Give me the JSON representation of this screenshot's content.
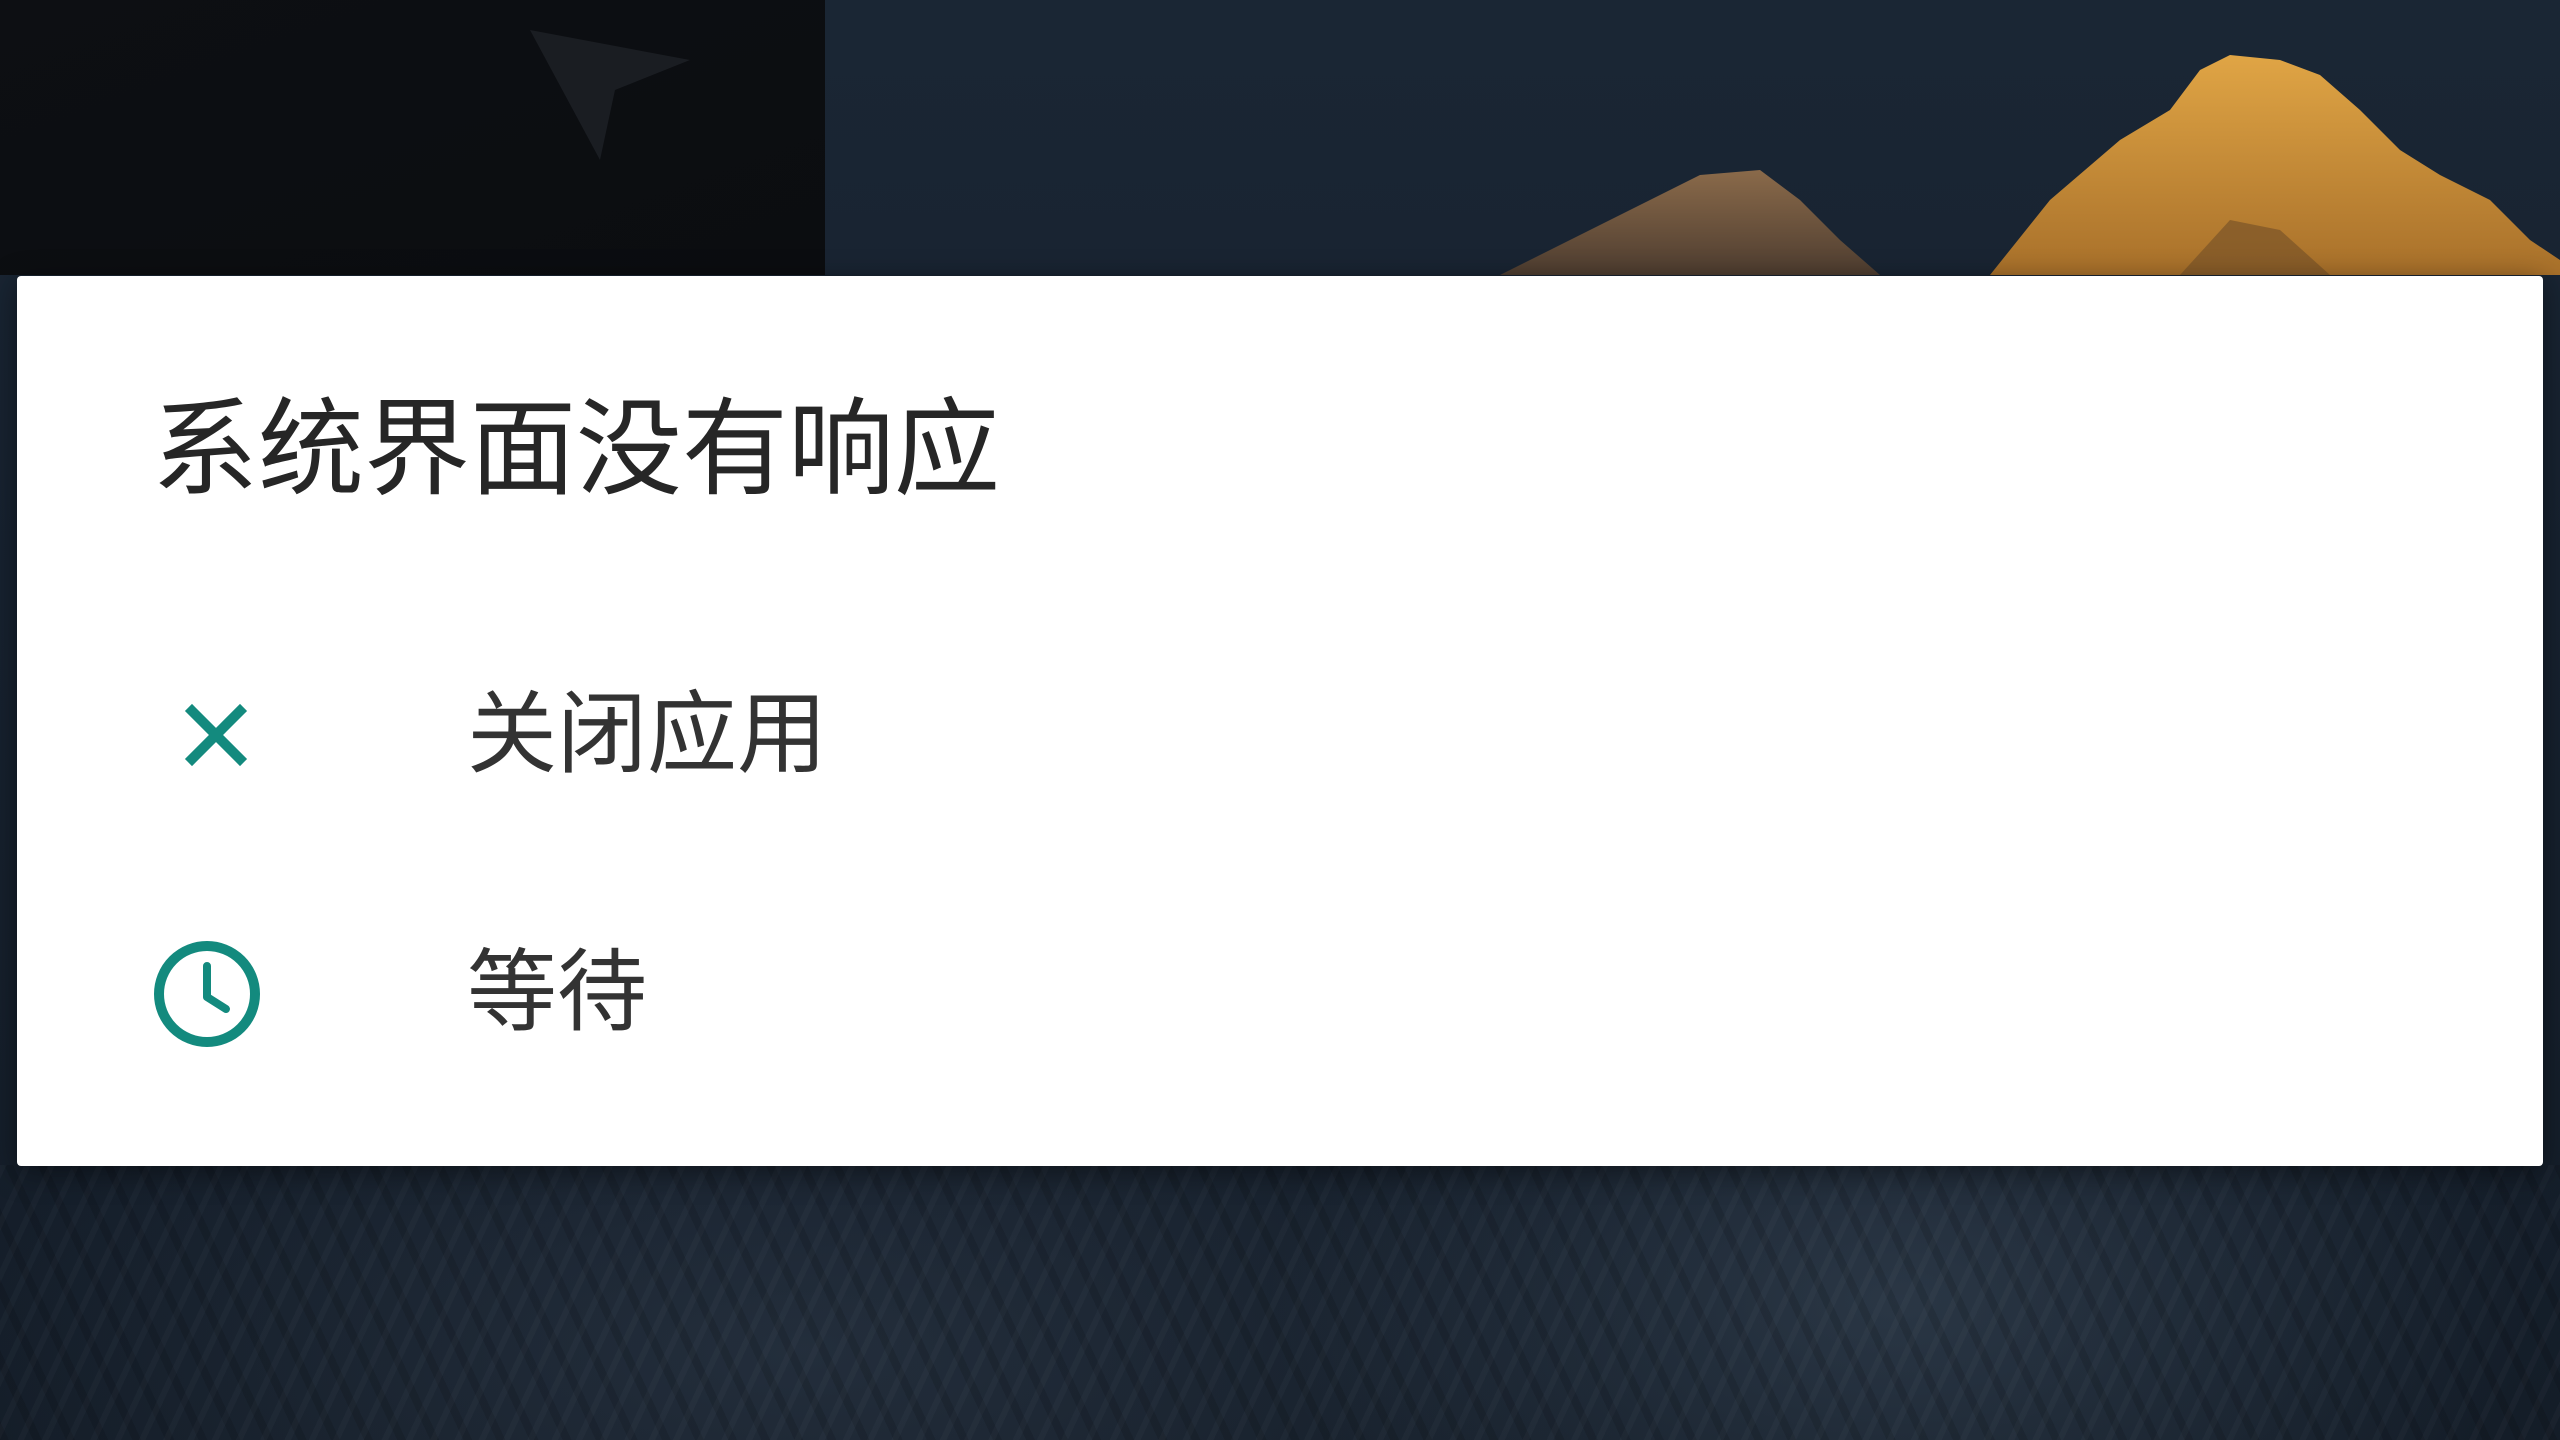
{
  "dialog": {
    "title": "系统界面没有响应",
    "options": [
      {
        "label": "关闭应用",
        "icon": "close-icon"
      },
      {
        "label": "等待",
        "icon": "clock-icon"
      }
    ]
  },
  "colors": {
    "accent": "#138a7e",
    "dialog_background": "#ffffff",
    "title_text": "#262626",
    "option_text": "#333333",
    "wallpaper": "#141d28"
  }
}
